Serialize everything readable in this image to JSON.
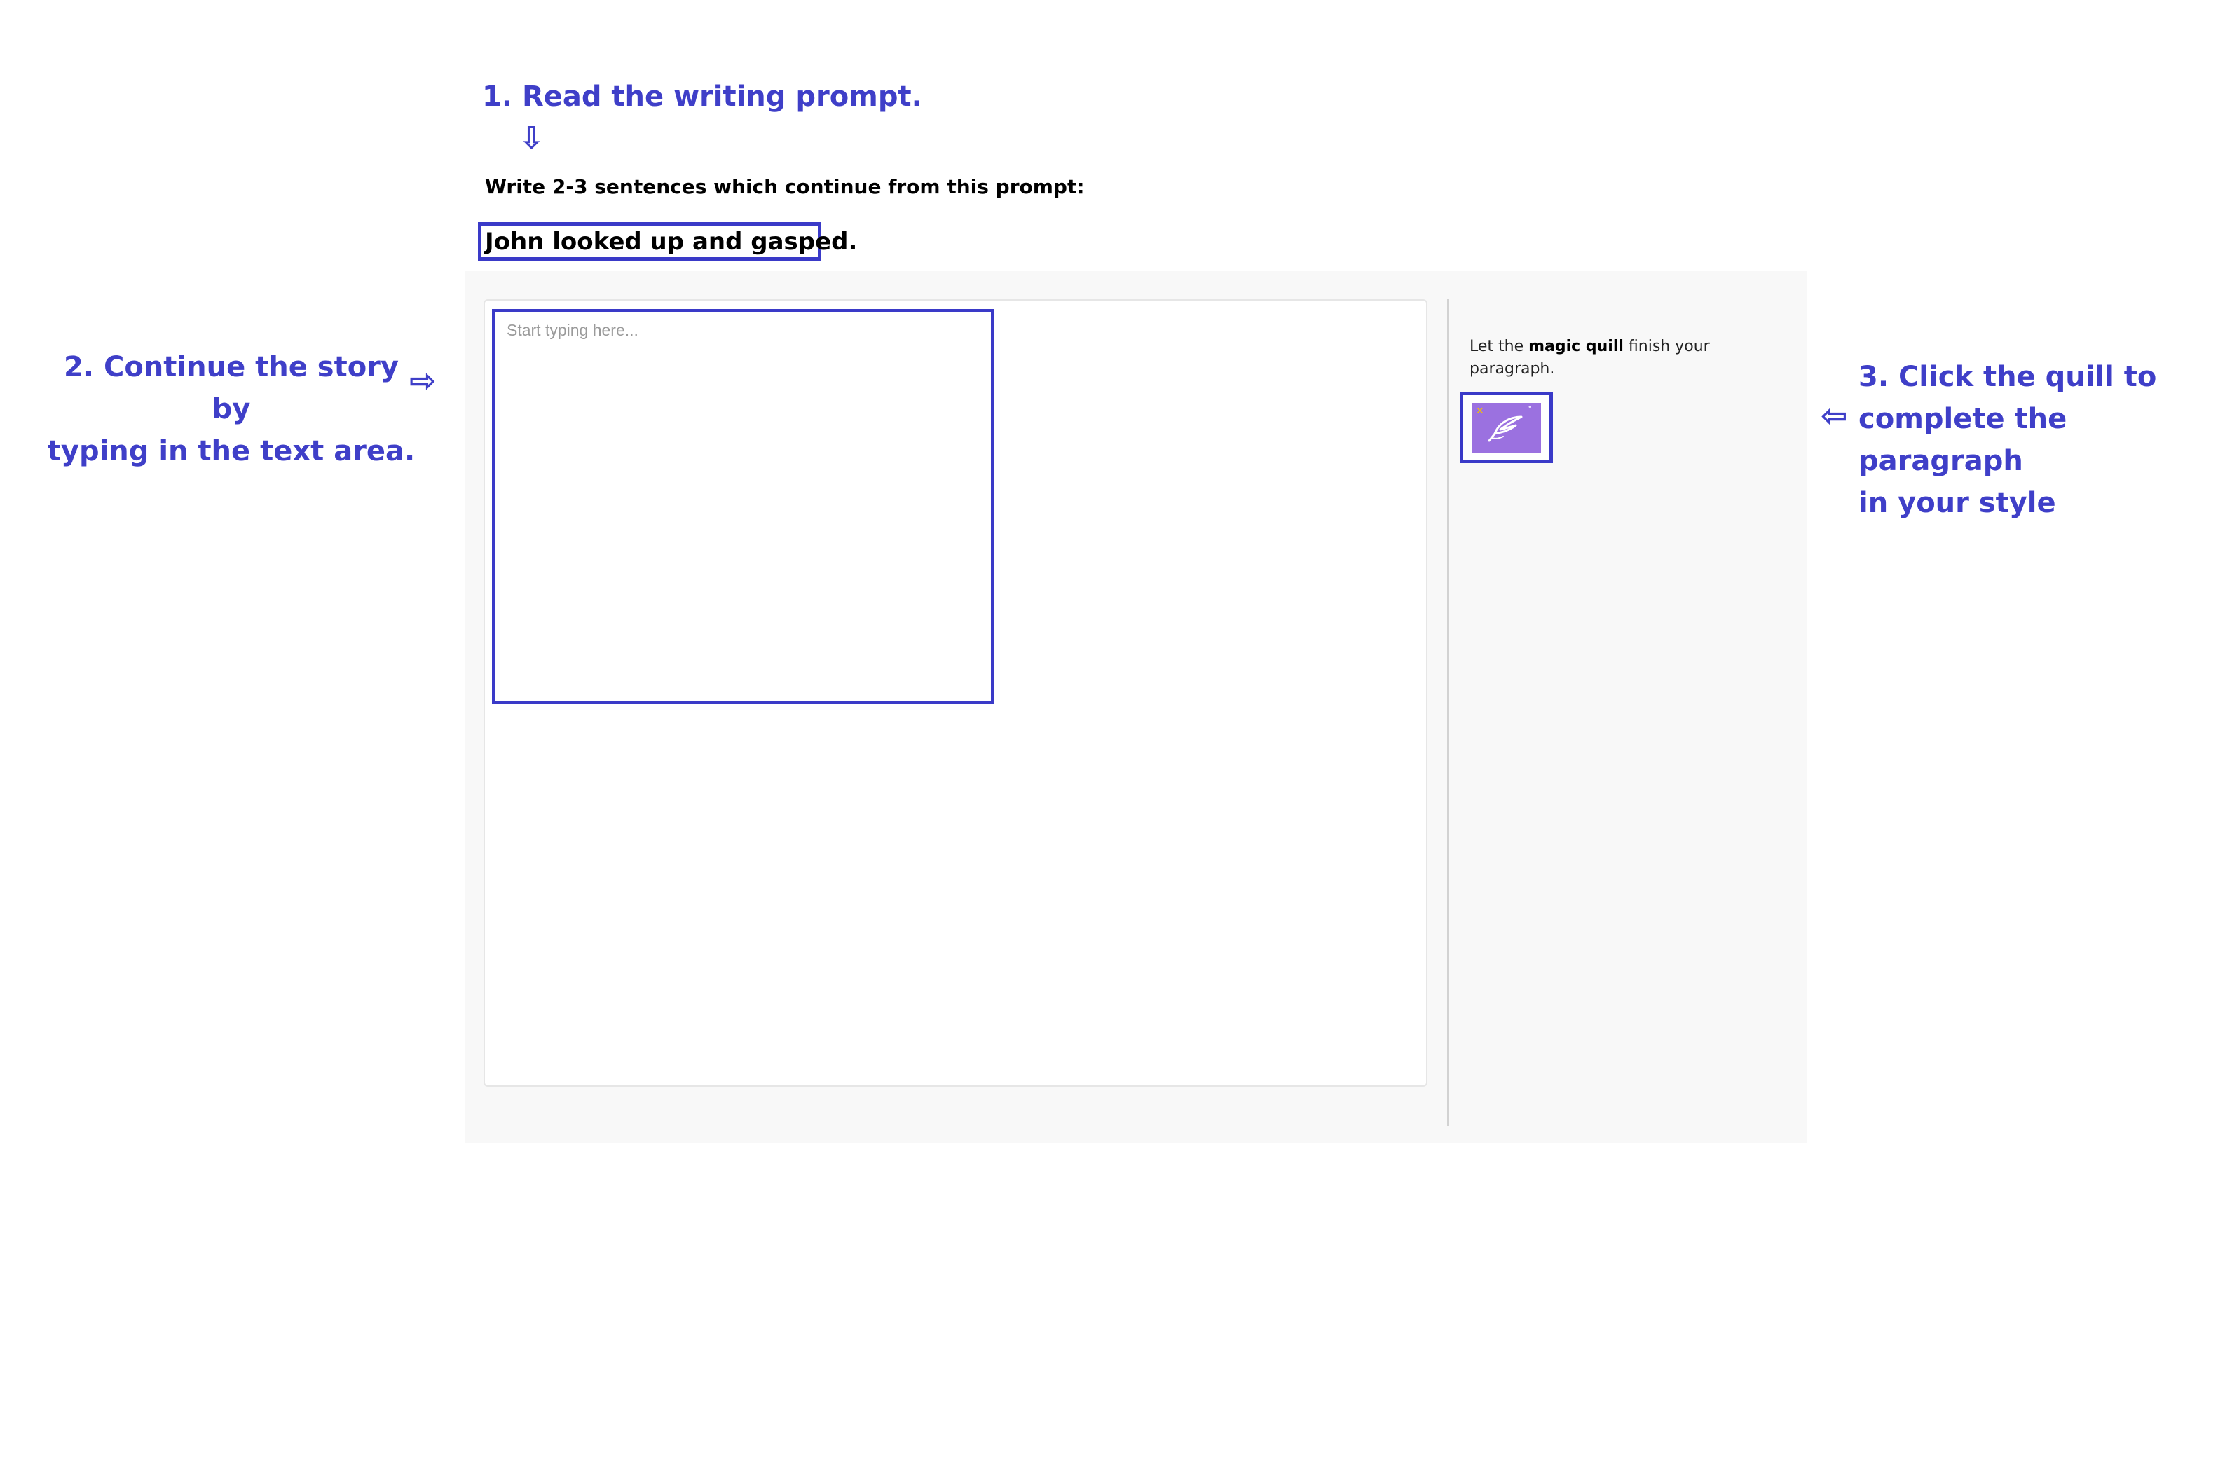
{
  "annotations": {
    "step1": "1. Read the writing prompt.",
    "step2_line1": "2. Continue the story by",
    "step2_line2": "typing in the text area.",
    "step3_line1": "3. Click the quill to",
    "step3_line2": "complete the paragraph",
    "step3_line3": "in your style",
    "color": "#3f3fc8"
  },
  "prompt_section": {
    "instruction": "Write 2-3 sentences which continue from this prompt:",
    "prompt": "John looked up and gasped."
  },
  "editor": {
    "placeholder": "Start typing here..."
  },
  "quill_panel": {
    "text_before": "Let the ",
    "text_bold": "magic quill",
    "text_after": " finish your paragraph.",
    "button_color": "#9b71e0"
  }
}
